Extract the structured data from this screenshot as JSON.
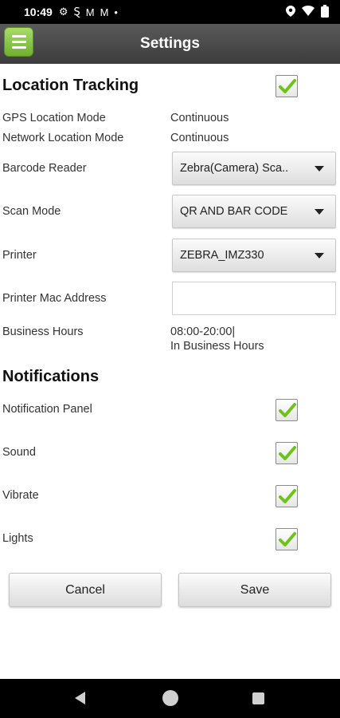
{
  "status_bar": {
    "time": "10:49",
    "icons": [
      "gear-icon",
      "s-app-icon",
      "gmail-icon",
      "gmail-icon",
      "dot-icon"
    ],
    "right_icons": [
      "location-icon",
      "wifi-icon",
      "battery-icon"
    ]
  },
  "header": {
    "title": "Settings",
    "menu_icon": "menu-icon"
  },
  "location": {
    "title": "Location Tracking",
    "enabled": true,
    "gps_label": "GPS Location Mode",
    "gps_value": "Continuous",
    "network_label": "Network Location Mode",
    "network_value": "Continuous",
    "barcode_label": "Barcode Reader",
    "barcode_value": "Zebra(Camera) Sca..",
    "scanmode_label": "Scan Mode",
    "scanmode_value": "QR AND BAR CODE",
    "printer_label": "Printer",
    "printer_value": "ZEBRA_IMZ330",
    "mac_label": "Printer Mac Address",
    "mac_value": "",
    "hours_label": "Business Hours",
    "hours_value": "08:00-20:00|",
    "hours_status": "In Business Hours"
  },
  "notifications": {
    "title": "Notifications",
    "panel_label": "Notification Panel",
    "panel_checked": true,
    "sound_label": "Sound",
    "sound_checked": true,
    "vibrate_label": "Vibrate",
    "vibrate_checked": true,
    "lights_label": "Lights",
    "lights_checked": true
  },
  "buttons": {
    "cancel": "Cancel",
    "save": "Save"
  },
  "colors": {
    "check_green": "#6cc417",
    "header_bg": "#4a4a4a",
    "menu_green": "#8cc84b"
  }
}
